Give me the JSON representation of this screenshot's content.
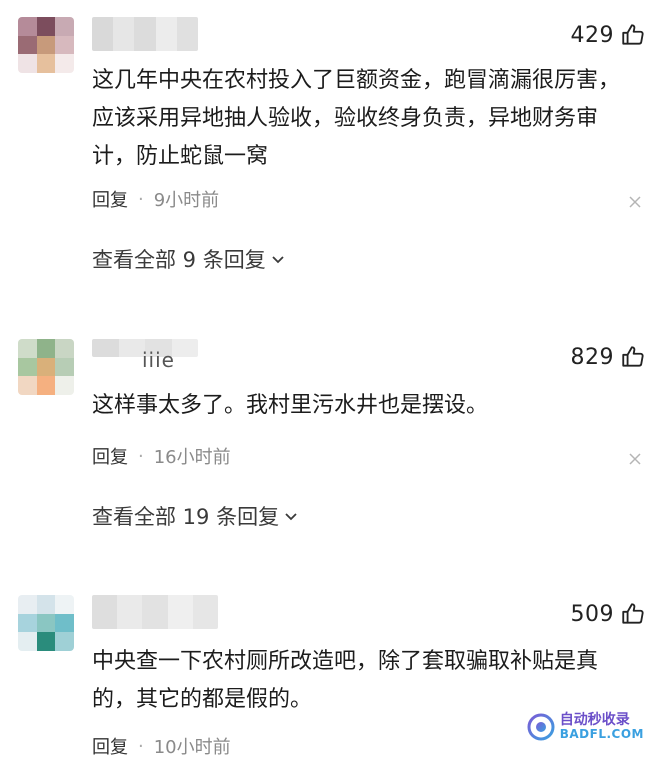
{
  "comments": [
    {
      "likes": "429",
      "text": "这几年中央在农村投入了巨额资金，跑冒滴漏很厉害，应该采用异地抽人验收，验收终身负责，异地财务审计，防止蛇鼠一窝",
      "reply_label": "回复",
      "separator": "·",
      "time": "9小时前",
      "view_replies": "查看全部 9 条回复",
      "avatar_colors": [
        "#b58b99",
        "#7c4d5d",
        "#c8aab3",
        "#9a6b74",
        "#c79a7b",
        "#d7b9be",
        "#efe3e5",
        "#e6c09d",
        "#f4eaea"
      ]
    },
    {
      "likes": "829",
      "text": "这样事太多了。我村里污水井也是摆设。",
      "reply_label": "回复",
      "separator": "·",
      "time": "16小时前",
      "view_replies": "查看全部 19 条回复",
      "username_partial": "iiie",
      "avatar_colors": [
        "#cfdcc9",
        "#8fb38a",
        "#c9d6c4",
        "#a8c7a0",
        "#d9b07a",
        "#b7cdb5",
        "#f1d7c2",
        "#f5b080",
        "#eef0ea"
      ]
    },
    {
      "likes": "509",
      "text": "中央查一下农村厕所改造吧，除了套取骗取补贴是真的，其它的都是假的。",
      "reply_label": "回复",
      "separator": "·",
      "time": "10小时前",
      "avatar_colors": [
        "#e8eef2",
        "#d4e3ea",
        "#eef3f5",
        "#a7d3dd",
        "#8ac6c2",
        "#6fbec9",
        "#e4eef1",
        "#2a8c7c",
        "#9fd0d6"
      ]
    }
  ],
  "watermark": {
    "cn": "自动秒收录",
    "en": "BADFL.COM"
  },
  "colors": {
    "text": "#1c1c1c",
    "meta_time": "#8a8a8a",
    "watermark_cn": "#6b4fc9",
    "watermark_en": "#3aa0e0"
  }
}
